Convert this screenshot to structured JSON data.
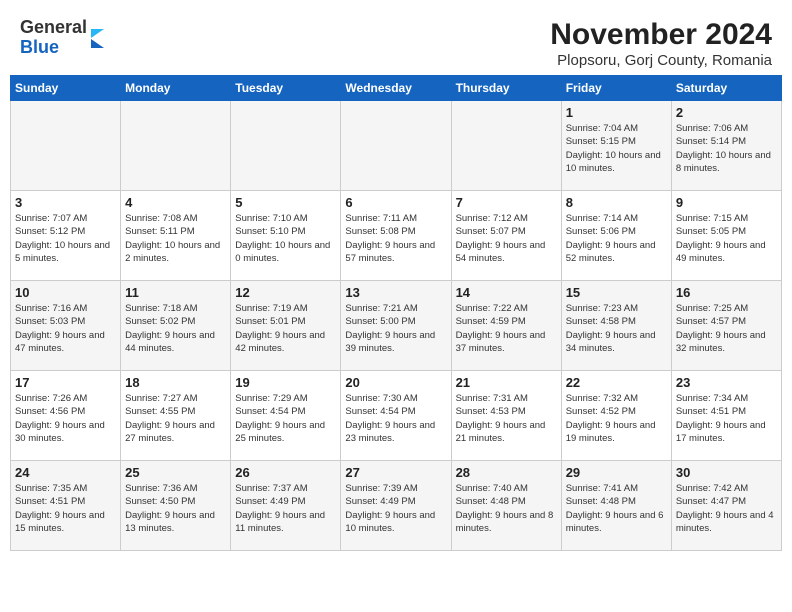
{
  "header": {
    "logo_line1": "General",
    "logo_line2": "Blue",
    "title": "November 2024",
    "subtitle": "Plopsoru, Gorj County, Romania"
  },
  "weekdays": [
    "Sunday",
    "Monday",
    "Tuesday",
    "Wednesday",
    "Thursday",
    "Friday",
    "Saturday"
  ],
  "weeks": [
    [
      {
        "day": "",
        "info": ""
      },
      {
        "day": "",
        "info": ""
      },
      {
        "day": "",
        "info": ""
      },
      {
        "day": "",
        "info": ""
      },
      {
        "day": "",
        "info": ""
      },
      {
        "day": "1",
        "info": "Sunrise: 7:04 AM\nSunset: 5:15 PM\nDaylight: 10 hours and 10 minutes."
      },
      {
        "day": "2",
        "info": "Sunrise: 7:06 AM\nSunset: 5:14 PM\nDaylight: 10 hours and 8 minutes."
      }
    ],
    [
      {
        "day": "3",
        "info": "Sunrise: 7:07 AM\nSunset: 5:12 PM\nDaylight: 10 hours and 5 minutes."
      },
      {
        "day": "4",
        "info": "Sunrise: 7:08 AM\nSunset: 5:11 PM\nDaylight: 10 hours and 2 minutes."
      },
      {
        "day": "5",
        "info": "Sunrise: 7:10 AM\nSunset: 5:10 PM\nDaylight: 10 hours and 0 minutes."
      },
      {
        "day": "6",
        "info": "Sunrise: 7:11 AM\nSunset: 5:08 PM\nDaylight: 9 hours and 57 minutes."
      },
      {
        "day": "7",
        "info": "Sunrise: 7:12 AM\nSunset: 5:07 PM\nDaylight: 9 hours and 54 minutes."
      },
      {
        "day": "8",
        "info": "Sunrise: 7:14 AM\nSunset: 5:06 PM\nDaylight: 9 hours and 52 minutes."
      },
      {
        "day": "9",
        "info": "Sunrise: 7:15 AM\nSunset: 5:05 PM\nDaylight: 9 hours and 49 minutes."
      }
    ],
    [
      {
        "day": "10",
        "info": "Sunrise: 7:16 AM\nSunset: 5:03 PM\nDaylight: 9 hours and 47 minutes."
      },
      {
        "day": "11",
        "info": "Sunrise: 7:18 AM\nSunset: 5:02 PM\nDaylight: 9 hours and 44 minutes."
      },
      {
        "day": "12",
        "info": "Sunrise: 7:19 AM\nSunset: 5:01 PM\nDaylight: 9 hours and 42 minutes."
      },
      {
        "day": "13",
        "info": "Sunrise: 7:21 AM\nSunset: 5:00 PM\nDaylight: 9 hours and 39 minutes."
      },
      {
        "day": "14",
        "info": "Sunrise: 7:22 AM\nSunset: 4:59 PM\nDaylight: 9 hours and 37 minutes."
      },
      {
        "day": "15",
        "info": "Sunrise: 7:23 AM\nSunset: 4:58 PM\nDaylight: 9 hours and 34 minutes."
      },
      {
        "day": "16",
        "info": "Sunrise: 7:25 AM\nSunset: 4:57 PM\nDaylight: 9 hours and 32 minutes."
      }
    ],
    [
      {
        "day": "17",
        "info": "Sunrise: 7:26 AM\nSunset: 4:56 PM\nDaylight: 9 hours and 30 minutes."
      },
      {
        "day": "18",
        "info": "Sunrise: 7:27 AM\nSunset: 4:55 PM\nDaylight: 9 hours and 27 minutes."
      },
      {
        "day": "19",
        "info": "Sunrise: 7:29 AM\nSunset: 4:54 PM\nDaylight: 9 hours and 25 minutes."
      },
      {
        "day": "20",
        "info": "Sunrise: 7:30 AM\nSunset: 4:54 PM\nDaylight: 9 hours and 23 minutes."
      },
      {
        "day": "21",
        "info": "Sunrise: 7:31 AM\nSunset: 4:53 PM\nDaylight: 9 hours and 21 minutes."
      },
      {
        "day": "22",
        "info": "Sunrise: 7:32 AM\nSunset: 4:52 PM\nDaylight: 9 hours and 19 minutes."
      },
      {
        "day": "23",
        "info": "Sunrise: 7:34 AM\nSunset: 4:51 PM\nDaylight: 9 hours and 17 minutes."
      }
    ],
    [
      {
        "day": "24",
        "info": "Sunrise: 7:35 AM\nSunset: 4:51 PM\nDaylight: 9 hours and 15 minutes."
      },
      {
        "day": "25",
        "info": "Sunrise: 7:36 AM\nSunset: 4:50 PM\nDaylight: 9 hours and 13 minutes."
      },
      {
        "day": "26",
        "info": "Sunrise: 7:37 AM\nSunset: 4:49 PM\nDaylight: 9 hours and 11 minutes."
      },
      {
        "day": "27",
        "info": "Sunrise: 7:39 AM\nSunset: 4:49 PM\nDaylight: 9 hours and 10 minutes."
      },
      {
        "day": "28",
        "info": "Sunrise: 7:40 AM\nSunset: 4:48 PM\nDaylight: 9 hours and 8 minutes."
      },
      {
        "day": "29",
        "info": "Sunrise: 7:41 AM\nSunset: 4:48 PM\nDaylight: 9 hours and 6 minutes."
      },
      {
        "day": "30",
        "info": "Sunrise: 7:42 AM\nSunset: 4:47 PM\nDaylight: 9 hours and 4 minutes."
      }
    ]
  ]
}
